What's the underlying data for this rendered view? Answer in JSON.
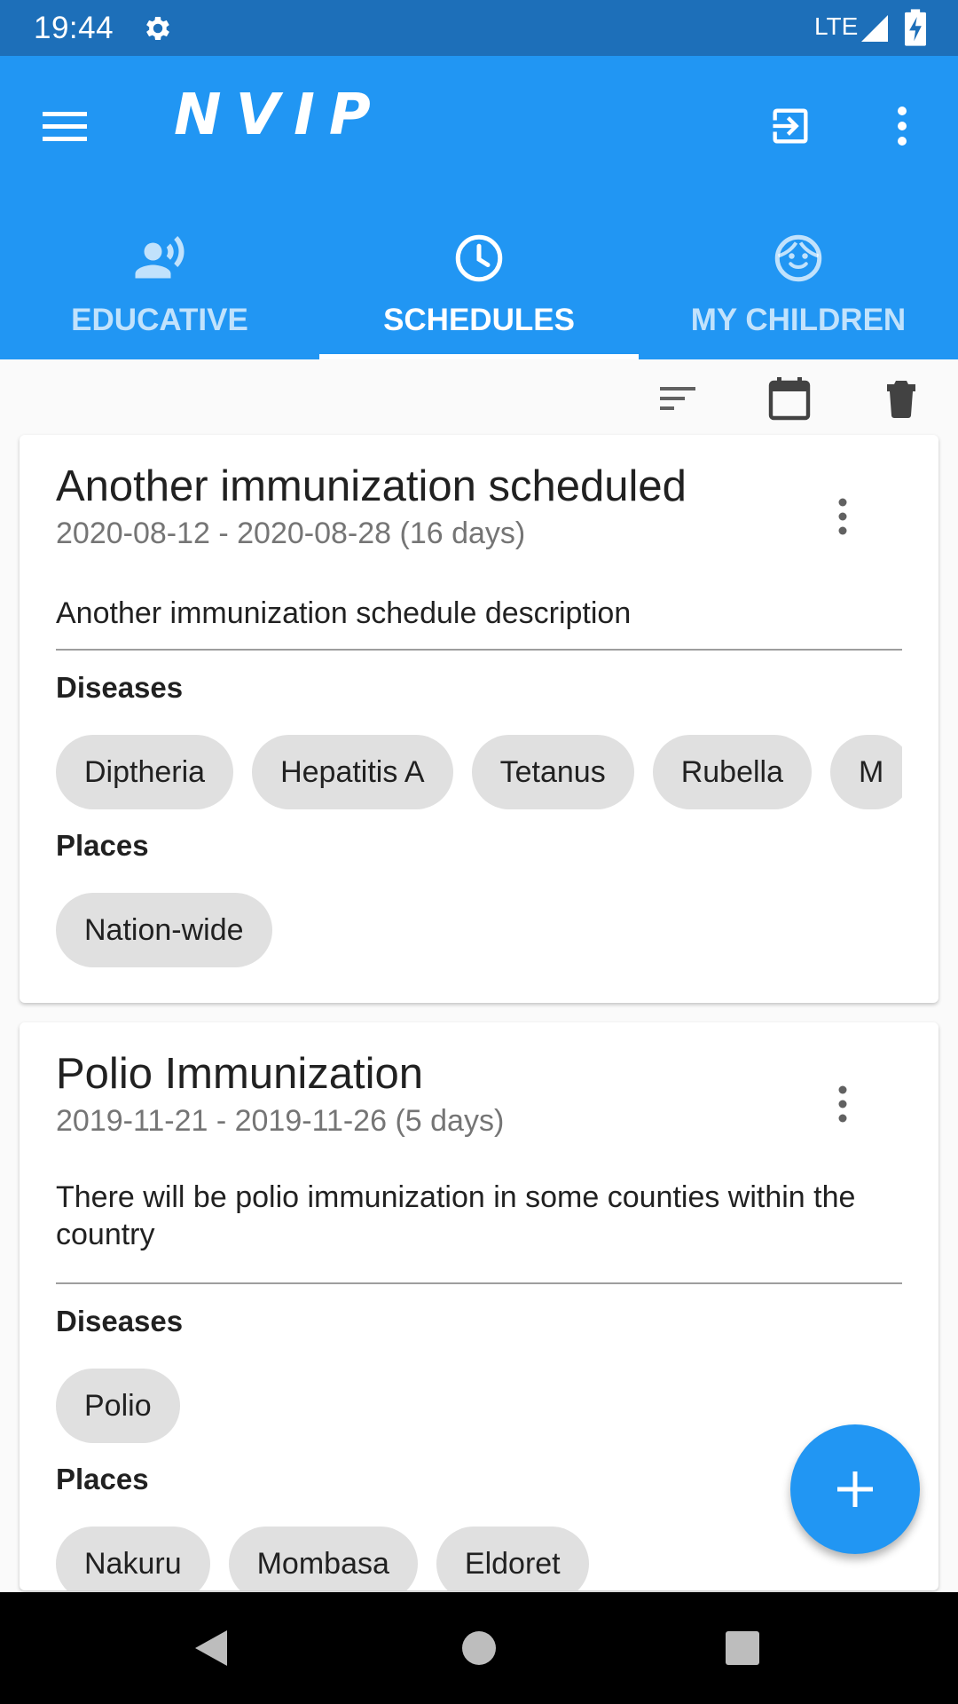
{
  "status_bar": {
    "time": "19:44",
    "network": "LTE"
  },
  "app_bar": {
    "title": "NVIP"
  },
  "tabs": [
    {
      "label": "EDUCATIVE",
      "icon": "record-voice-icon",
      "active": false
    },
    {
      "label": "SCHEDULES",
      "icon": "clock-icon",
      "active": true
    },
    {
      "label": "MY CHILDREN",
      "icon": "child-face-icon",
      "active": false
    }
  ],
  "toolbar": {
    "icons": [
      "sort-icon",
      "calendar-icon",
      "delete-icon"
    ]
  },
  "schedules": [
    {
      "title": "Another immunization scheduled",
      "dates": "2020-08-12 - 2020-08-28 (16 days)",
      "description": "Another immunization schedule description",
      "diseases_label": "Diseases",
      "diseases": [
        "Diptheria",
        "Hepatitis A",
        "Tetanus",
        "Rubella",
        "M"
      ],
      "places_label": "Places",
      "places": [
        "Nation-wide"
      ]
    },
    {
      "title": "Polio Immunization",
      "dates": "2019-11-21 - 2019-11-26 (5 days)",
      "description": "There will be polio immunization in some counties within the country",
      "diseases_label": "Diseases",
      "diseases": [
        "Polio"
      ],
      "places_label": "Places",
      "places": [
        "Nakuru",
        "Mombasa",
        "Eldoret"
      ]
    }
  ],
  "fab": {
    "icon": "add-icon"
  },
  "nav_bar": {
    "icons": [
      "back-icon",
      "home-icon",
      "recents-icon"
    ]
  },
  "colors": {
    "primary": "#2196f3",
    "status_bar": "#1d6fb9",
    "chip": "#e0e0e0"
  }
}
